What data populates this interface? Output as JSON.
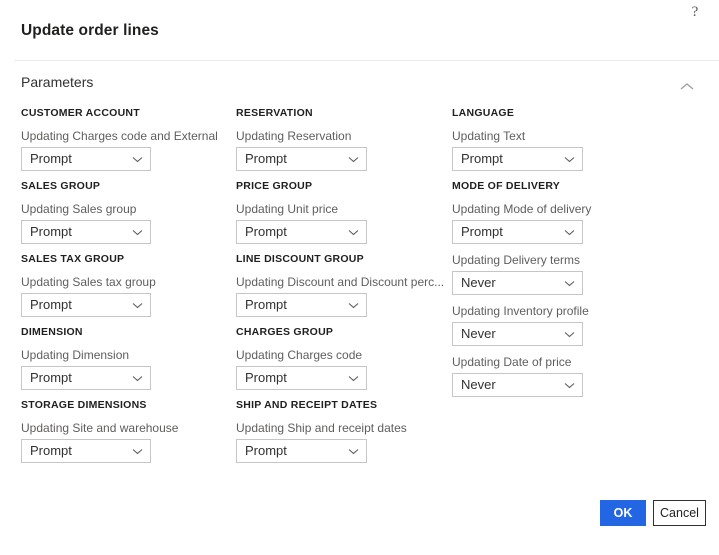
{
  "dialog": {
    "title": "Update order lines",
    "help_icon": "question-mark-icon"
  },
  "section": {
    "title": "Parameters",
    "collapse_icon": "chevron-up-icon",
    "expanded": true
  },
  "columns": [
    {
      "name": "column-1",
      "groups": [
        {
          "heading": "CUSTOMER ACCOUNT",
          "fields": [
            {
              "label": "Updating Charges code and External",
              "value": "Prompt"
            }
          ]
        },
        {
          "heading": "SALES GROUP",
          "fields": [
            {
              "label": "Updating Sales group",
              "value": "Prompt"
            }
          ]
        },
        {
          "heading": "SALES TAX GROUP",
          "fields": [
            {
              "label": "Updating Sales tax group",
              "value": "Prompt"
            }
          ]
        },
        {
          "heading": "DIMENSION",
          "fields": [
            {
              "label": "Updating Dimension",
              "value": "Prompt"
            }
          ]
        },
        {
          "heading": "STORAGE DIMENSIONS",
          "fields": [
            {
              "label": "Updating Site and warehouse",
              "value": "Prompt"
            }
          ]
        }
      ]
    },
    {
      "name": "column-2",
      "groups": [
        {
          "heading": "RESERVATION",
          "fields": [
            {
              "label": "Updating Reservation",
              "value": "Prompt"
            }
          ]
        },
        {
          "heading": "PRICE GROUP",
          "fields": [
            {
              "label": "Updating Unit price",
              "value": "Prompt"
            }
          ]
        },
        {
          "heading": "LINE DISCOUNT GROUP",
          "fields": [
            {
              "label": "Updating Discount and Discount perc...",
              "value": "Prompt"
            }
          ]
        },
        {
          "heading": "CHARGES GROUP",
          "fields": [
            {
              "label": "Updating Charges code",
              "value": "Prompt"
            }
          ]
        },
        {
          "heading": "SHIP AND RECEIPT DATES",
          "fields": [
            {
              "label": "Updating Ship and receipt dates",
              "value": "Prompt"
            }
          ]
        }
      ]
    },
    {
      "name": "column-3",
      "groups": [
        {
          "heading": "LANGUAGE",
          "fields": [
            {
              "label": "Updating Text",
              "value": "Prompt"
            }
          ]
        },
        {
          "heading": "MODE OF DELIVERY",
          "fields": [
            {
              "label": "Updating Mode of delivery",
              "value": "Prompt"
            },
            {
              "label": "Updating Delivery terms",
              "value": "Never"
            },
            {
              "label": "Updating Inventory profile",
              "value": "Never"
            },
            {
              "label": "Updating Date of price",
              "value": "Never"
            }
          ]
        }
      ]
    }
  ],
  "footer": {
    "ok_label": "OK",
    "cancel_label": "Cancel"
  },
  "colors": {
    "accent": "#2266e3",
    "text": "#323130",
    "muted_text": "#605e5c",
    "border": "#c8c6c4",
    "rule": "#edebe9"
  }
}
